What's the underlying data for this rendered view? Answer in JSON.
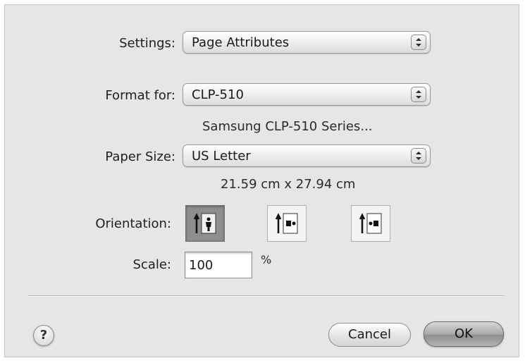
{
  "settings": {
    "label": "Settings:",
    "value": "Page Attributes"
  },
  "format_for": {
    "label": "Format for:",
    "value": "CLP-510",
    "description": "Samsung CLP-510 Series..."
  },
  "paper_size": {
    "label": "Paper Size:",
    "value": "US Letter",
    "dimensions": "21.59 cm x 27.94 cm"
  },
  "orientation": {
    "label": "Orientation:",
    "options": [
      {
        "icon": "portrait-orientation-icon",
        "selected": true
      },
      {
        "icon": "landscape-left-orientation-icon",
        "selected": false
      },
      {
        "icon": "landscape-right-orientation-icon",
        "selected": false
      }
    ]
  },
  "scale": {
    "label": "Scale:",
    "value": "100",
    "unit": "%"
  },
  "buttons": {
    "help": "?",
    "cancel": "Cancel",
    "ok": "OK"
  }
}
